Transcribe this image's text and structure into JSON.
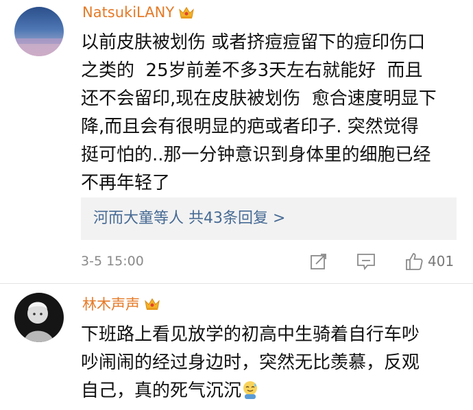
{
  "comments": [
    {
      "username": "NatsukiLANY",
      "text": "以前皮肤被划伤 或者挤痘痘留下的痘印伤口\n之类的  25岁前差不多3天左右就能好  而且\n还不会留印,现在皮肤被划伤  愈合速度明显下\n降,而且会有很明显的疤或者印子. 突然觉得\n挺可怕的..那一分钟意识到身体里的细胞已经\n不再年轻了",
      "reply_summary": "河而大童等人  共43条回复 >",
      "timestamp": "3-5 15:00",
      "like_count": "401"
    },
    {
      "username": "林木声声",
      "text": "下班路上看见放学的初高中生骑着自行车吵\n吵闹闹的经过身边时，突然无比羡慕，反观\n自己，真的死气沉沉"
    }
  ],
  "colors": {
    "username": "#e57a27",
    "link": "#466a94",
    "meta": "#8a8a8a",
    "reply_bg": "#f2f2f2"
  },
  "icons": {
    "badge": "crown-vip-icon",
    "share": "share-icon",
    "comment": "comment-icon",
    "like": "thumbs-up-icon",
    "emoji": "sweat-smile-emoji"
  }
}
